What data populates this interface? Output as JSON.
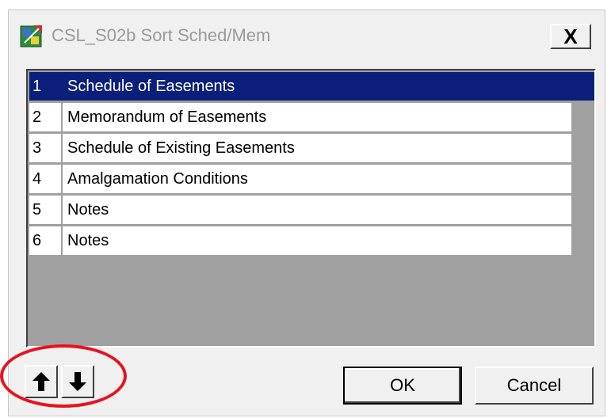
{
  "window": {
    "title": "CSL_S02b Sort Sched/Mem",
    "close_label": "X"
  },
  "list": {
    "items": [
      {
        "num": "1",
        "label": "Schedule of Easements",
        "selected": true
      },
      {
        "num": "2",
        "label": "Memorandum of Easements"
      },
      {
        "num": "3",
        "label": "Schedule of Existing Easements"
      },
      {
        "num": "4",
        "label": "Amalgamation Conditions"
      },
      {
        "num": "5",
        "label": "Notes"
      },
      {
        "num": "6",
        "label": "Notes"
      }
    ]
  },
  "buttons": {
    "move_up_icon": "arrow-up-icon",
    "move_down_icon": "arrow-down-icon",
    "ok_label": "OK",
    "cancel_label": "Cancel"
  },
  "colors": {
    "selection": "#0a1f7a",
    "annotation": "#e8121c"
  }
}
